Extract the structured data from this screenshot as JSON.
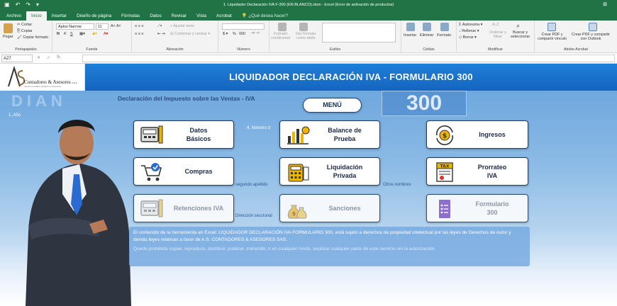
{
  "window": {
    "title": "1. Liquidador Declaración IVA F-300 (EN BLANCO).xlsm - Excel (Error de activación de productos)"
  },
  "tabs": [
    {
      "label": "Archivo",
      "active": false
    },
    {
      "label": "Inicio",
      "active": true
    },
    {
      "label": "Insertar",
      "active": false
    },
    {
      "label": "Diseño de página",
      "active": false
    },
    {
      "label": "Fórmulas",
      "active": false
    },
    {
      "label": "Datos",
      "active": false
    },
    {
      "label": "Revisar",
      "active": false
    },
    {
      "label": "Vista",
      "active": false
    },
    {
      "label": "Acrobat",
      "active": false
    }
  ],
  "tell_me": "¿Qué desea hacer?",
  "ribbon": {
    "clipboard": {
      "paste": "Pegar",
      "cut": "Cortar",
      "copy": "Copiar",
      "format_painter": "Copiar formato",
      "group": "Portapapeles"
    },
    "font": {
      "name": "Aptos Narrow",
      "size": "11",
      "bold": "N",
      "italic": "K",
      "underline": "S",
      "group": "Fuente"
    },
    "alignment": {
      "wrap": "Ajustar texto",
      "merge": "Combinar y centrar",
      "group": "Alineación"
    },
    "number": {
      "currency": "$",
      "percent": "%",
      "thousands": "000",
      "group": "Número"
    },
    "styles": {
      "conditional": "Formato\ncondicional",
      "as_table": "Dar formato\ncomo tabla",
      "group": "Estilos"
    },
    "cells": {
      "insert": "Insertar",
      "delete": "Eliminar",
      "format": "Formato",
      "group": "Celdas"
    },
    "editing": {
      "autosum": "Autosuma",
      "fill": "Rellenar",
      "clear": "Borrar",
      "sort": "Ordenar y\nfiltrar",
      "find": "Buscar y\nseleccionar",
      "group": "Modificar"
    },
    "acrobat": {
      "create_link": "Crear PDF y\ncompartir vínculo",
      "create_outlook": "Crear PDF y compartir\ncon Outlook",
      "group": "Adobe Acrobat"
    }
  },
  "formula_bar": {
    "name_box": "A27",
    "fx": "fx",
    "value": ""
  },
  "logo": {
    "company": "Contadores & Asesores",
    "suffix": "S.A.S",
    "tagline": "Servicios Contables Tributarios y Financieros"
  },
  "banner": {
    "title": "LIQUIDADOR DECLARACIÓN IVA - FORMULARIO 300"
  },
  "form_bg": {
    "dian": "DIAN",
    "heading": "Declaración del Impuesto sobre las Ventas - IVA",
    "number": "300",
    "year": "1. Año",
    "field4": "4. Número d",
    "second_surname": "segundo apellido",
    "other_names": "Otros nombres",
    "address": "Dirección seccional"
  },
  "menu": {
    "label": "MENÚ"
  },
  "buttons": [
    {
      "id": "datos-basicos",
      "label": "Datos\nBásicos",
      "icon": "register-icon",
      "enabled": true
    },
    {
      "id": "balance-prueba",
      "label": "Balance de\nPrueba",
      "icon": "balance-chart-icon",
      "enabled": true
    },
    {
      "id": "ingresos",
      "label": "Ingresos",
      "icon": "money-cycle-icon",
      "enabled": true
    },
    {
      "id": "compras",
      "label": "Compras",
      "icon": "shopping-cart-icon",
      "enabled": true
    },
    {
      "id": "liquidacion-privada",
      "label": "Liquidación\nPrivada",
      "icon": "calculator-icon",
      "enabled": true
    },
    {
      "id": "prorrateo-iva",
      "label": "Prorrateo\nIVA",
      "icon": "tax-document-icon",
      "enabled": true
    },
    {
      "id": "retenciones-iva",
      "label": "Retenciones IVA",
      "icon": "register-icon",
      "enabled": false
    },
    {
      "id": "sanciones",
      "label": "Sanciones",
      "icon": "money-bags-icon",
      "enabled": false
    },
    {
      "id": "formulario-300",
      "label": "Formulario\n300",
      "icon": "form-icon",
      "enabled": false
    }
  ],
  "notice": {
    "text": "El contenido de la herramienta en Excel: LIQUIDADOR DECLARACIÓN IVA FORMULARIO 300, está sujeto a derechos de propiedad intelectual por las leyes de Derechos de Autor y demás leyes relativas a favor de A.S. CONTADORES & ASESORES SAS.",
    "warning": "Queda prohibido copiar, reproducir, distribuir, publicar, transmitir, o en cualquier modo, explotar cualquier parte de este servicio sin la autorización."
  },
  "colors": {
    "excel_green": "#217346",
    "banner_blue": "#1565c0",
    "button_border": "#1c3d66"
  }
}
